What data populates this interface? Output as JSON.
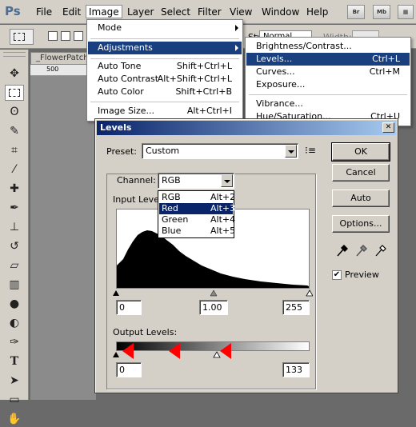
{
  "menubar": {
    "logo": "Ps",
    "items": [
      "File",
      "Edit",
      "Image",
      "Layer",
      "Select",
      "Filter",
      "View",
      "Window",
      "Help"
    ],
    "bridge_btn": "Br",
    "minibridge_btn": "Mb"
  },
  "options_bar": {
    "style_label": "Style:",
    "style_value": "Normal",
    "width_label": "Width:"
  },
  "document": {
    "tab_label": "_FlowerPatch",
    "ruler_mark": "500"
  },
  "image_menu": {
    "items": [
      {
        "label": "Mode",
        "shortcut": "",
        "submenu": true
      },
      {
        "label": "Adjustments",
        "shortcut": "",
        "submenu": true
      },
      {
        "label": "Auto Tone",
        "shortcut": "Shift+Ctrl+L"
      },
      {
        "label": "Auto Contrast",
        "shortcut": "Alt+Shift+Ctrl+L"
      },
      {
        "label": "Auto Color",
        "shortcut": "Shift+Ctrl+B"
      },
      {
        "label": "Image Size...",
        "shortcut": "Alt+Ctrl+I"
      }
    ]
  },
  "adjustments_menu": {
    "items": [
      {
        "label": "Brightness/Contrast...",
        "shortcut": ""
      },
      {
        "label": "Levels...",
        "shortcut": "Ctrl+L"
      },
      {
        "label": "Curves...",
        "shortcut": "Ctrl+M"
      },
      {
        "label": "Exposure...",
        "shortcut": ""
      },
      {
        "label": "Vibrance...",
        "shortcut": ""
      },
      {
        "label": "Hue/Saturation...",
        "shortcut": "Ctrl+U"
      }
    ]
  },
  "levels_dialog": {
    "title": "Levels",
    "close_glyph": "✕",
    "preset_label": "Preset:",
    "preset_value": "Custom",
    "channel_label": "Channel:",
    "channel_value": "RGB",
    "channel_options": [
      {
        "label": "RGB",
        "shortcut": "Alt+2"
      },
      {
        "label": "Red",
        "shortcut": "Alt+3"
      },
      {
        "label": "Green",
        "shortcut": "Alt+4"
      },
      {
        "label": "Blue",
        "shortcut": "Alt+5"
      }
    ],
    "input_levels_label": "Input Levels:",
    "input_black": "0",
    "input_gamma": "1.00",
    "input_white": "255",
    "output_levels_label": "Output Levels:",
    "output_black": "0",
    "output_white": "133",
    "buttons": {
      "ok": "OK",
      "cancel": "Cancel",
      "auto": "Auto",
      "options": "Options..."
    },
    "preview_label": "Preview",
    "preview_checked": true
  },
  "colors": {
    "menu_highlight": "#1a3f7e",
    "title_gradient_start": "#0a246a",
    "annotation_arrow": "#ff0000"
  }
}
